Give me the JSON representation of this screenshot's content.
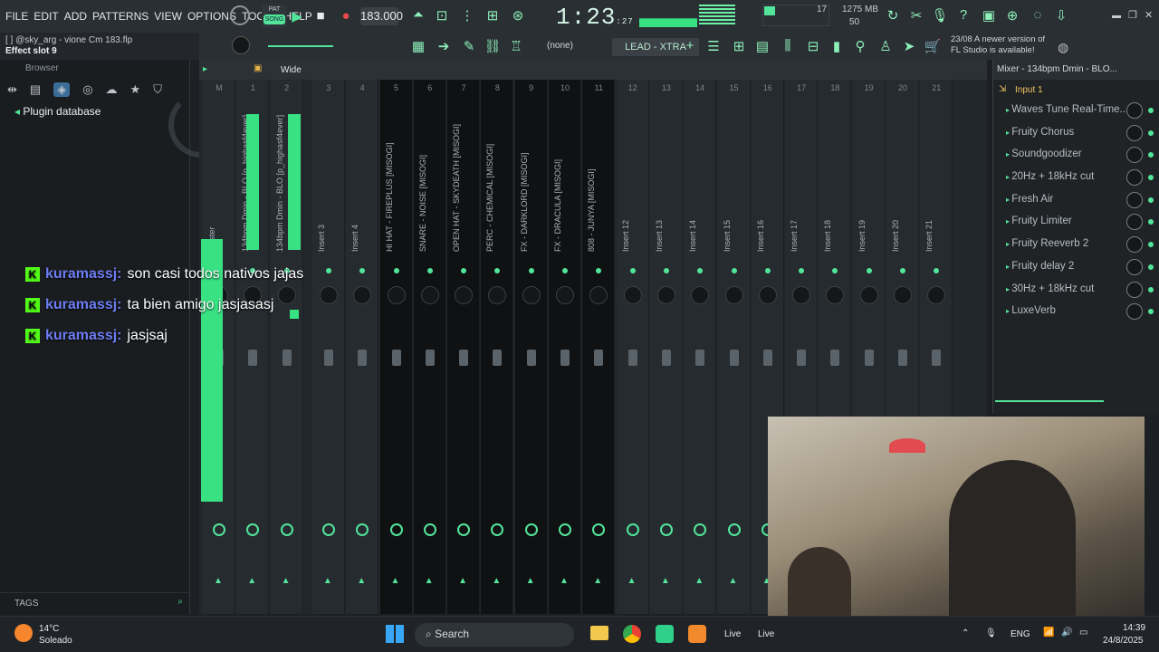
{
  "menu": [
    "FILE",
    "EDIT",
    "ADD",
    "PATTERNS",
    "VIEW",
    "OPTIONS",
    "TOOLS",
    "HELP"
  ],
  "transport": {
    "pat": "PAT",
    "song": "SONG",
    "bpm": "183.000",
    "time": "1:23",
    "time_sub": ":27",
    "cpu": "17",
    "ram": "1275 MB",
    "poly": "50"
  },
  "hint": {
    "line1": "[   ] @sky_arg - vione Cm 183.flp",
    "line2": "Effect slot 9"
  },
  "pattern_selector": "(none)",
  "preset": "LEAD - XTRA",
  "news": {
    "date": "23/08",
    "line1": "A newer version of",
    "line2": "FL Studio is available!"
  },
  "browser": {
    "title": "Browser",
    "plugin_db": "Plugin database",
    "tags": "TAGS"
  },
  "mixer": {
    "wide_label": "Wide"
  },
  "strips": [
    {
      "num": "M",
      "label": "Master",
      "dark": false
    },
    {
      "num": "1",
      "label": "134bpm Dmin - BLO [p_highasf4ever]",
      "dark": false
    },
    {
      "num": "2",
      "label": "134bpm Dmin - BLO [p_highasf4ever]",
      "dark": false
    },
    {
      "num": "3",
      "label": "Insert 3",
      "dark": false
    },
    {
      "num": "4",
      "label": "Insert 4",
      "dark": false
    },
    {
      "num": "5",
      "label": "HI HAT - FIREPLUS [MISOGI]",
      "dark": true
    },
    {
      "num": "6",
      "label": "SNARE - NOISE [MISOGI]",
      "dark": true
    },
    {
      "num": "7",
      "label": "OPEN HAT - SKYDEATH [MISOGI]",
      "dark": true
    },
    {
      "num": "8",
      "label": "PERC - CHEMICAL [MISOGI]",
      "dark": true
    },
    {
      "num": "9",
      "label": "FX - DARKLORD [MISOGI]",
      "dark": true
    },
    {
      "num": "10",
      "label": "FX - DRACULA [MISOGI]",
      "dark": true
    },
    {
      "num": "11",
      "label": "808 - JUNYA [MISOGI]",
      "dark": true
    },
    {
      "num": "12",
      "label": "Insert 12",
      "dark": false
    },
    {
      "num": "13",
      "label": "Insert 13",
      "dark": false
    },
    {
      "num": "14",
      "label": "Insert 14",
      "dark": false
    },
    {
      "num": "15",
      "label": "Insert 15",
      "dark": false
    },
    {
      "num": "16",
      "label": "Insert 16",
      "dark": false
    },
    {
      "num": "17",
      "label": "Insert 17",
      "dark": false
    },
    {
      "num": "18",
      "label": "Insert 18",
      "dark": false
    },
    {
      "num": "19",
      "label": "Insert 19",
      "dark": false
    },
    {
      "num": "20",
      "label": "Insert 20",
      "dark": false
    },
    {
      "num": "21",
      "label": "Insert 21",
      "dark": false
    }
  ],
  "mixer_panel": {
    "title": "Mixer - 134bpm Dmin - BLO...",
    "input": "Input 1",
    "slots": [
      "Waves Tune Real-Time...",
      "Fruity Chorus",
      "Soundgoodizer",
      "20Hz + 18kHz cut",
      "Fresh Air",
      "Fruity Limiter",
      "Fruity Reeverb 2",
      "Fruity delay 2",
      "30Hz + 18kHz cut",
      "LuxeVerb"
    ]
  },
  "chat": [
    {
      "user": "kuramassj:",
      "msg": "son casi todos nativos jajas"
    },
    {
      "user": "kuramassj:",
      "msg": "ta bien amigo jasjasasj"
    },
    {
      "user": "kuramassj:",
      "msg": "jasjsaj"
    }
  ],
  "taskbar": {
    "temp": "14°C",
    "weather": "Soleado",
    "search": "Search",
    "lang": "ENG",
    "time": "14:39",
    "date": "24/8/2025",
    "live1": "Live",
    "live2": "Live"
  }
}
